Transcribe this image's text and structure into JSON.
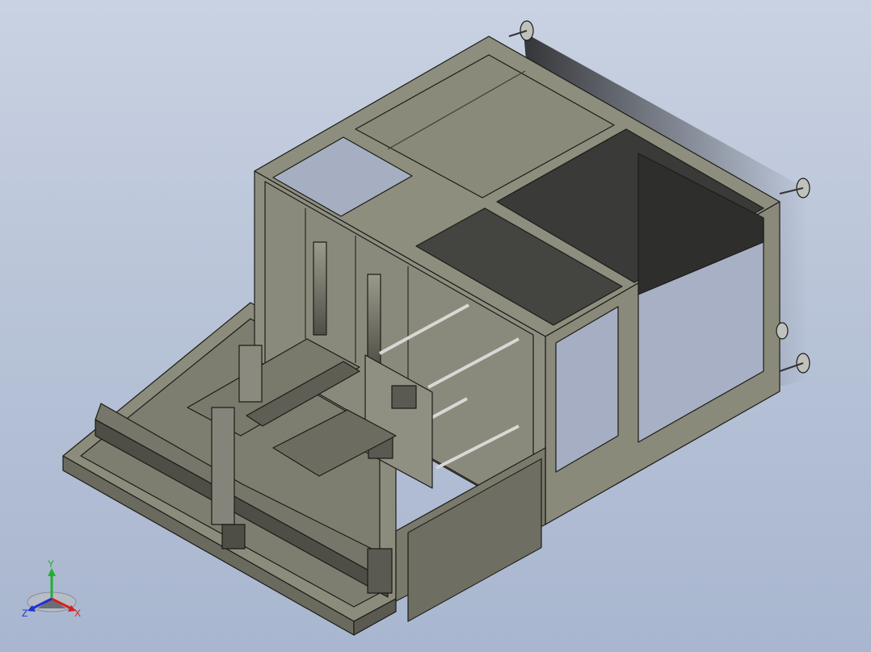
{
  "viewport": {
    "background_top": "#c9d2e2",
    "background_bottom": "#a8b6cf"
  },
  "model": {
    "body_color": "#8a8a7a",
    "body_dark": "#5e5e52",
    "edge_color": "#1c1c18",
    "rod_color": "#d8d8d4"
  },
  "triad": {
    "x_label": "X",
    "y_label": "Y",
    "z_label": "Z",
    "x_color": "#d42020",
    "y_color": "#20b030",
    "z_color": "#2030d0"
  }
}
